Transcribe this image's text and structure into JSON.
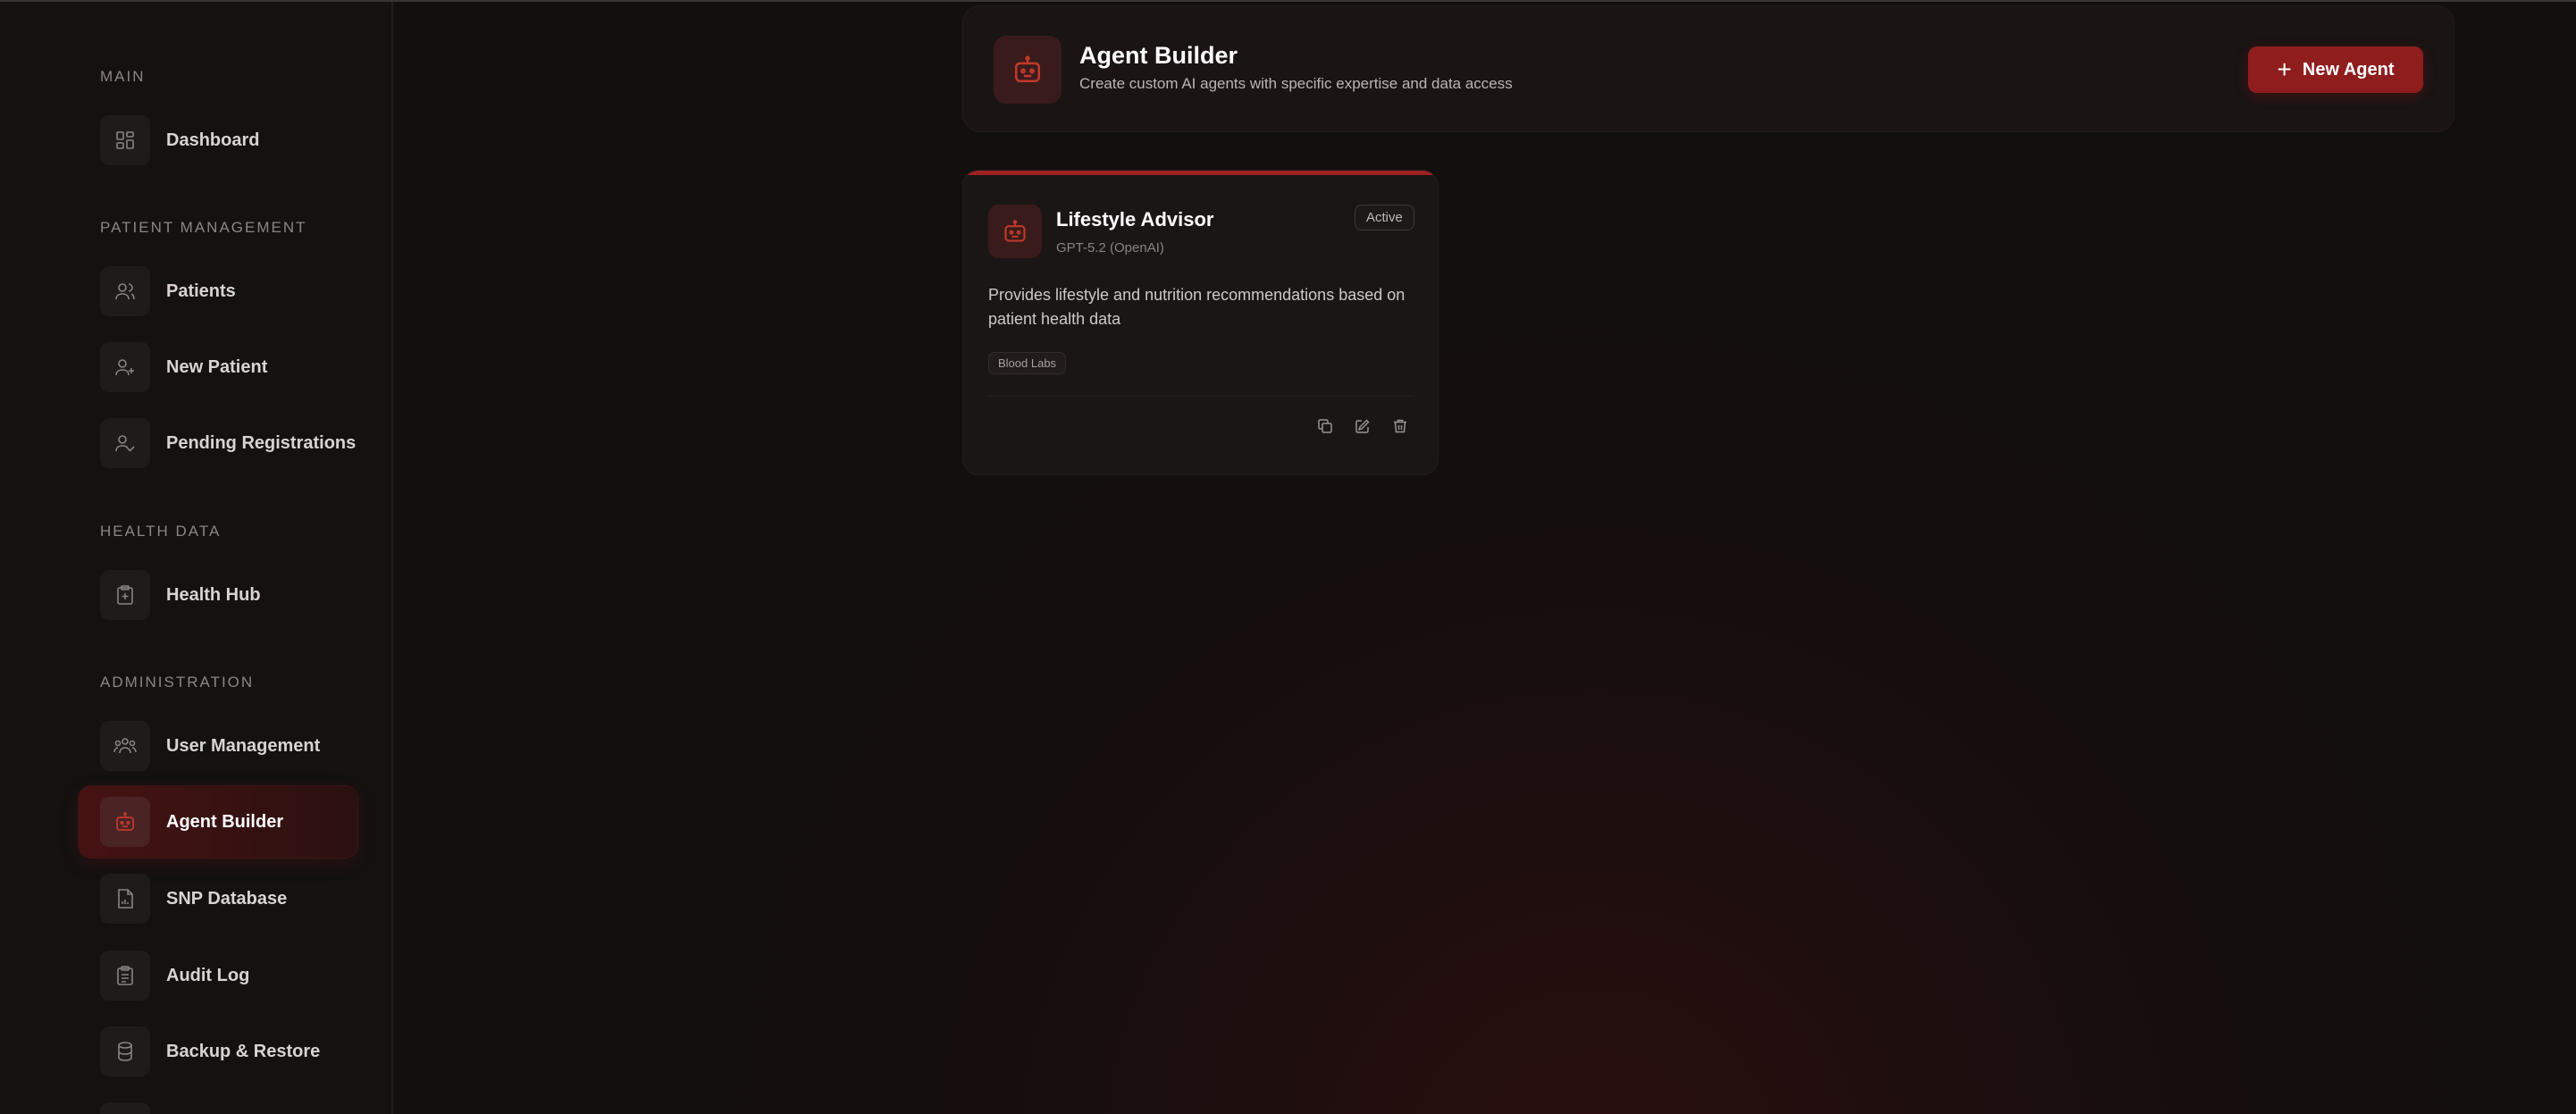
{
  "sidebar": {
    "sections": [
      {
        "label": "MAIN",
        "items": [
          {
            "label": "Dashboard",
            "icon": "dashboard-icon"
          }
        ]
      },
      {
        "label": "PATIENT MANAGEMENT",
        "items": [
          {
            "label": "Patients",
            "icon": "users-icon"
          },
          {
            "label": "New Patient",
            "icon": "user-plus-icon"
          },
          {
            "label": "Pending Registrations",
            "icon": "user-check-icon"
          }
        ]
      },
      {
        "label": "HEALTH DATA",
        "items": [
          {
            "label": "Health Hub",
            "icon": "clipboard-heart-icon"
          }
        ]
      },
      {
        "label": "ADMINISTRATION",
        "items": [
          {
            "label": "User Management",
            "icon": "user-group-icon"
          },
          {
            "label": "Agent Builder",
            "icon": "bot-icon",
            "active": true
          },
          {
            "label": "SNP Database",
            "icon": "file-data-icon"
          },
          {
            "label": "Audit Log",
            "icon": "clipboard-list-icon"
          },
          {
            "label": "Backup & Restore",
            "icon": "database-icon"
          }
        ]
      }
    ]
  },
  "header": {
    "title": "Agent Builder",
    "subtitle": "Create custom AI agents with specific expertise and data access",
    "new_agent_label": "New Agent",
    "icon": "bot-icon"
  },
  "agents": [
    {
      "name": "Lifestyle Advisor",
      "model": "GPT-5.2 (OpenAI)",
      "status": "Active",
      "description": "Provides lifestyle and nutrition recommendations based on patient health data",
      "tags": [
        "Blood Labs"
      ],
      "actions": [
        "copy-icon",
        "edit-icon",
        "delete-icon"
      ]
    }
  ],
  "colors": {
    "background": "#120f0f",
    "accent": "#8f1d1d",
    "active_icon": "#c0392b"
  }
}
